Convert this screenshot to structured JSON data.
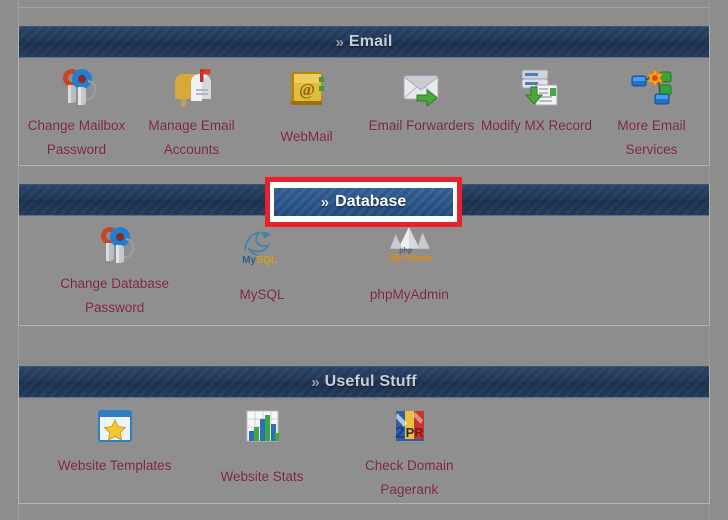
{
  "sections": [
    {
      "id": "email",
      "title": "Email",
      "chevron": "»",
      "highlighted": false,
      "items": [
        {
          "label": "Change Mailbox Password",
          "icon": "keys-icon"
        },
        {
          "label": "Manage Email Accounts",
          "icon": "mailbox-icon"
        },
        {
          "label": "WebMail",
          "icon": "address-book-at-icon"
        },
        {
          "label": "Email Forwarders",
          "icon": "envelope-forward-icon"
        },
        {
          "label": "Modify MX Record",
          "icon": "server-record-icon"
        },
        {
          "label": "More Email Services",
          "icon": "network-nodes-icon"
        }
      ]
    },
    {
      "id": "database",
      "title": "Database",
      "chevron": "»",
      "highlighted": true,
      "items": [
        {
          "label": "Change Database Password",
          "icon": "keys-icon"
        },
        {
          "label": "MySQL",
          "icon": "mysql-dolphin-icon"
        },
        {
          "label": "phpMyAdmin",
          "icon": "phpmyadmin-icon"
        }
      ]
    },
    {
      "id": "useful",
      "title": "Useful Stuff",
      "chevron": "»",
      "highlighted": false,
      "items": [
        {
          "label": "Website Templates",
          "icon": "window-star-icon"
        },
        {
          "label": "Website Stats",
          "icon": "bar-chart-icon"
        },
        {
          "label": "Check Domain Pagerank",
          "icon": "pagerank-2pr-icon"
        }
      ]
    }
  ],
  "colors": {
    "page_background": "#8d8d8d",
    "header_navy": "#1e3553",
    "header_highlight_blue": "#2a5386",
    "highlight_border_red": "#e8222a",
    "label_text": "#7b2341",
    "header_text": "#c9cfd6"
  }
}
